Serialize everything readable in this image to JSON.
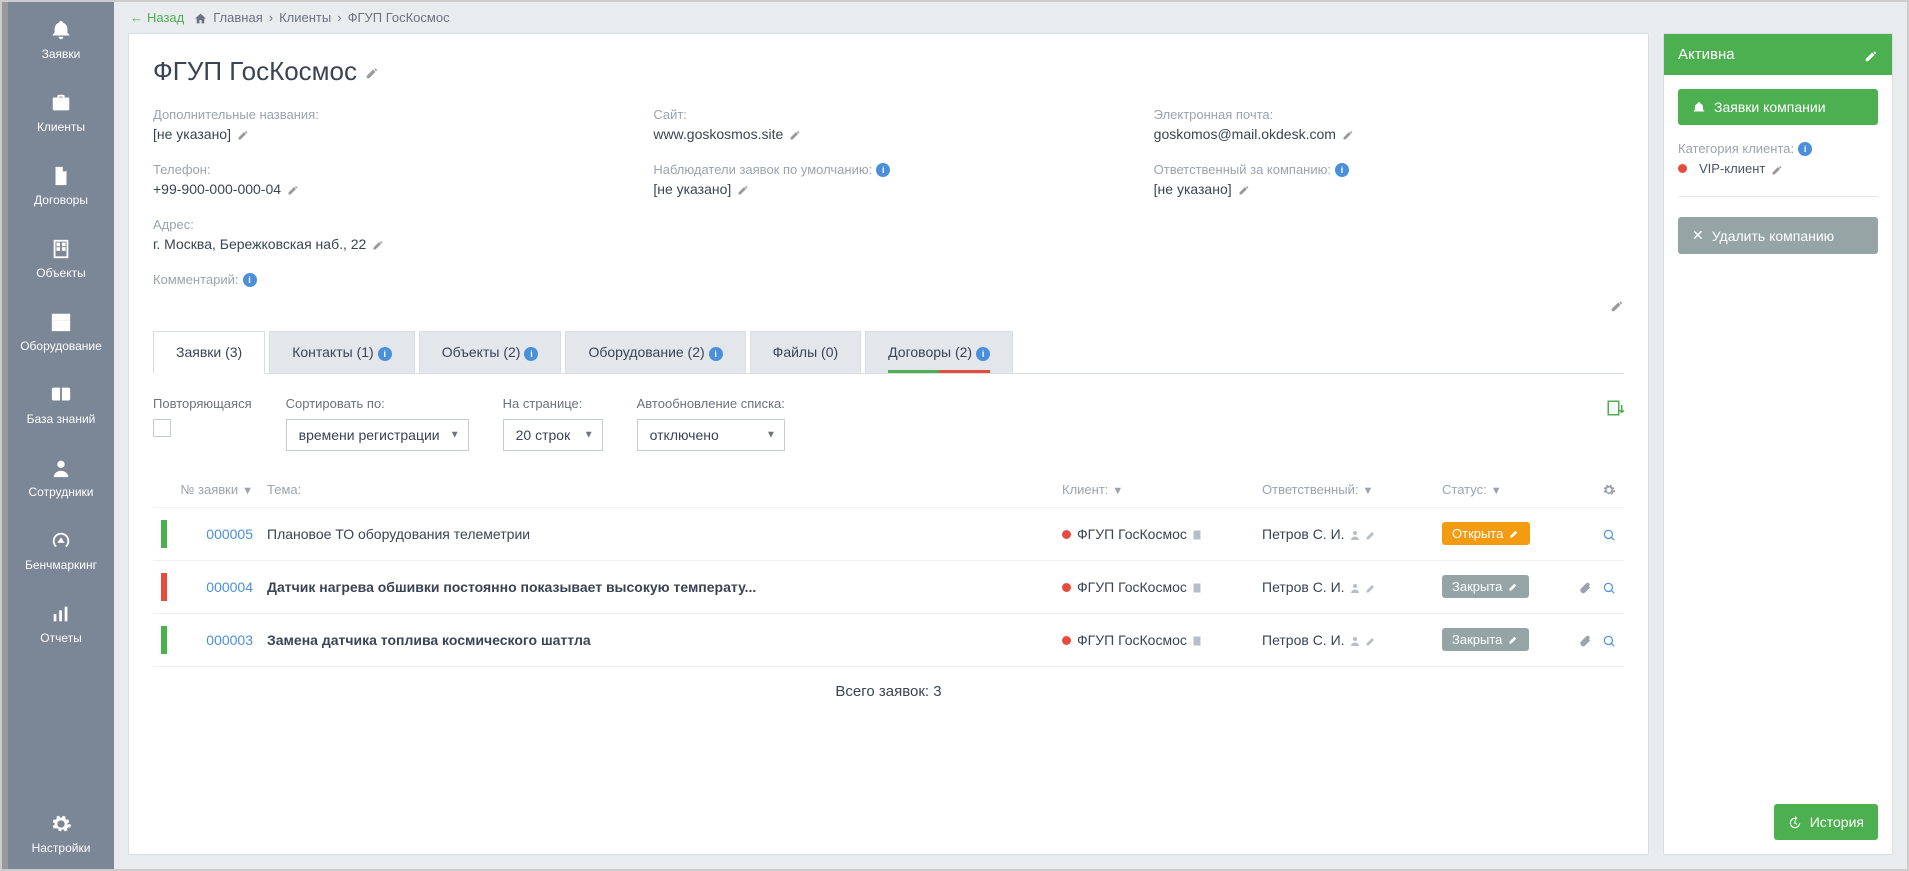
{
  "sidebar": {
    "items": [
      {
        "label": "Заявки",
        "icon": "bell"
      },
      {
        "label": "Клиенты",
        "icon": "briefcase"
      },
      {
        "label": "Договоры",
        "icon": "doc"
      },
      {
        "label": "Объекты",
        "icon": "building"
      },
      {
        "label": "Оборудование",
        "icon": "server"
      },
      {
        "label": "База знаний",
        "icon": "book"
      },
      {
        "label": "Сотрудники",
        "icon": "user"
      },
      {
        "label": "Бенчмаркинг",
        "icon": "gauge"
      },
      {
        "label": "Отчеты",
        "icon": "chart"
      }
    ],
    "settings_label": "Настройки"
  },
  "topbar": {
    "back": "Назад",
    "home": "Главная",
    "clients": "Клиенты",
    "current": "ФГУП ГосКосмос"
  },
  "page": {
    "title": "ФГУП ГосКосмос",
    "fields": {
      "alt_names_label": "Дополнительные названия:",
      "alt_names_value": "[не указано]",
      "site_label": "Сайт:",
      "site_value": "www.goskosmos.site",
      "email_label": "Электронная почта:",
      "email_value": "goskomos@mail.okdesk.com",
      "phone_label": "Телефон:",
      "phone_value": "+99-900-000-000-04",
      "watchers_label": "Наблюдатели заявок по умолчанию:",
      "watchers_value": "[не указано]",
      "responsible_label": "Ответственный за компанию:",
      "responsible_value": "[не указано]",
      "address_label": "Адрес:",
      "address_value": "г. Москва, Бережковская наб., 22",
      "comment_label": "Комментарий:"
    }
  },
  "tabs": [
    {
      "label": "Заявки (3)"
    },
    {
      "label": "Контакты (1)"
    },
    {
      "label": "Объекты (2)"
    },
    {
      "label": "Оборудование (2)"
    },
    {
      "label": "Файлы (0)"
    },
    {
      "label": "Договоры (2)"
    }
  ],
  "filters": {
    "recurring_label": "Повторяющаяся",
    "sort_label": "Сортировать по:",
    "sort_value": "времени регистрации",
    "perpage_label": "На странице:",
    "perpage_value": "20 строк",
    "auto_label": "Автообновление списка:",
    "auto_value": "отключено"
  },
  "table": {
    "head": {
      "num": "№ заявки",
      "topic": "Тема:",
      "client": "Клиент:",
      "resp": "Ответственный:",
      "status": "Статус:"
    },
    "rows": [
      {
        "bar": "green",
        "id": "000005",
        "topic": "Плановое ТО оборудования телеметрии",
        "bold": false,
        "client": "ФГУП ГосКосмос",
        "resp": "Петров С. И.",
        "status": "Открыта",
        "status_class": "status-open",
        "attach": false
      },
      {
        "bar": "red",
        "id": "000004",
        "topic": "Датчик нагрева обшивки постоянно показывает высокую температу...",
        "bold": true,
        "client": "ФГУП ГосКосмос",
        "resp": "Петров С. И.",
        "status": "Закрыта",
        "status_class": "status-closed",
        "attach": true
      },
      {
        "bar": "green",
        "id": "000003",
        "topic": "Замена датчика топлива космического шаттла",
        "bold": true,
        "client": "ФГУП ГосКосмос",
        "resp": "Петров С. И.",
        "status": "Закрыта",
        "status_class": "status-closed",
        "attach": true
      }
    ],
    "total": "Всего заявок: 3"
  },
  "right": {
    "status": "Активна",
    "requests_btn": "Заявки компании",
    "category_label": "Категория клиента:",
    "category_value": "VIP-клиент",
    "delete_btn": "Удалить компанию",
    "history_btn": "История"
  }
}
